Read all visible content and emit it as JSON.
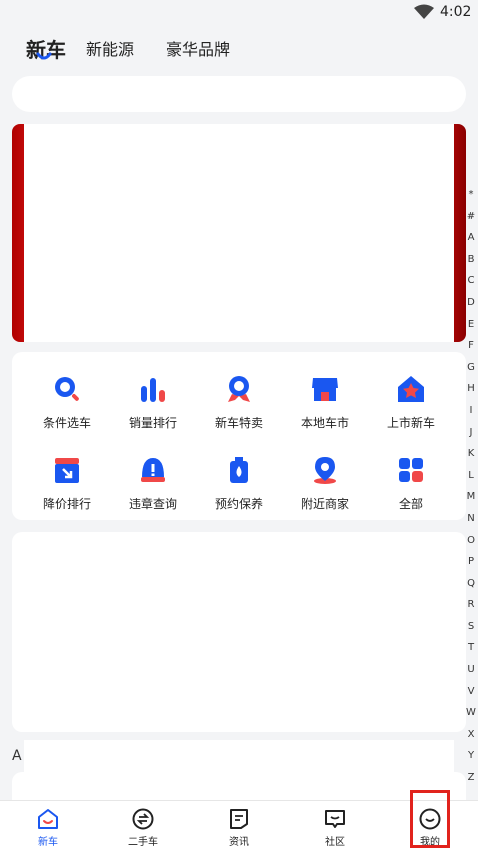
{
  "status": {
    "time": "4:02"
  },
  "top_tabs": [
    {
      "label": "新车",
      "active": true
    },
    {
      "label": "新能源",
      "active": false
    },
    {
      "label": "豪华品牌",
      "active": false
    }
  ],
  "quick_entries": [
    {
      "label": "条件选车",
      "icon": "search-icon"
    },
    {
      "label": "销量排行",
      "icon": "bar-chart-icon"
    },
    {
      "label": "新车特卖",
      "icon": "ribbon-badge-icon"
    },
    {
      "label": "本地车市",
      "icon": "store-icon"
    },
    {
      "label": "上市新车",
      "icon": "star-house-icon"
    },
    {
      "label": "降价排行",
      "icon": "price-down-icon"
    },
    {
      "label": "违章查询",
      "icon": "warning-icon"
    },
    {
      "label": "预约保养",
      "icon": "oil-bottle-icon"
    },
    {
      "label": "附近商家",
      "icon": "location-pin-icon"
    },
    {
      "label": "全部",
      "icon": "grid-icon"
    }
  ],
  "section_letter": "A",
  "index_letters": [
    "*",
    "#",
    "A",
    "B",
    "C",
    "D",
    "E",
    "F",
    "G",
    "H",
    "I",
    "J",
    "K",
    "L",
    "M",
    "N",
    "O",
    "P",
    "Q",
    "R",
    "S",
    "T",
    "U",
    "V",
    "W",
    "X",
    "Y",
    "Z"
  ],
  "bottom_nav": [
    {
      "label": "新车",
      "icon": "new-car-home-icon",
      "active": true
    },
    {
      "label": "二手车",
      "icon": "exchange-icon",
      "active": false
    },
    {
      "label": "资讯",
      "icon": "news-icon",
      "active": false
    },
    {
      "label": "社区",
      "icon": "community-icon",
      "active": false
    },
    {
      "label": "我的",
      "icon": "profile-face-icon",
      "active": false
    }
  ],
  "colors": {
    "accent": "#1a57f0",
    "red": "#f04848",
    "highlight": "#e1231d"
  }
}
